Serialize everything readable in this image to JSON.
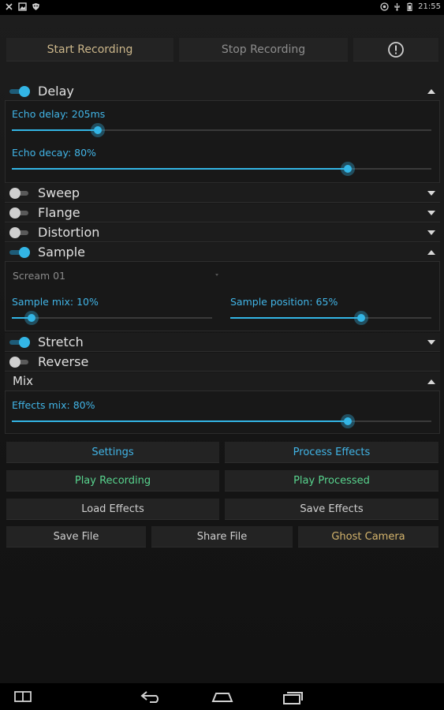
{
  "status_bar": {
    "left_icons": [
      "close-icon",
      "photo-icon",
      "shield-icon"
    ],
    "right_icons": [
      "chrome-icon",
      "usb-icon",
      "battery-icon"
    ],
    "time": "21:55"
  },
  "colors": {
    "accent": "#33b5e5",
    "label_blue": "#41b4e6",
    "label_green": "#58d48e",
    "label_gold": "#d4b46c"
  },
  "top_buttons": {
    "start_label": "Start Recording",
    "stop_label": "Stop Recording",
    "info_icon": "info-icon"
  },
  "delay": {
    "label": "Delay",
    "enabled": true,
    "expanded": true,
    "echo_delay_label": "Echo delay: 205ms",
    "echo_delay_fraction": 0.205,
    "echo_decay_label": "Echo decay: 80%",
    "echo_decay_fraction": 0.8
  },
  "sweep": {
    "label": "Sweep",
    "enabled": false,
    "expanded": false
  },
  "flange": {
    "label": "Flange",
    "enabled": false,
    "expanded": false
  },
  "distortion": {
    "label": "Distortion",
    "enabled": false,
    "expanded": false
  },
  "sample": {
    "label": "Sample",
    "enabled": true,
    "expanded": true,
    "selected": "Scream 01",
    "mix_label": "Sample mix: 10%",
    "mix_fraction": 0.1,
    "position_label": "Sample position: 65%",
    "position_fraction": 0.65
  },
  "stretch": {
    "label": "Stretch",
    "enabled": true,
    "expanded": false
  },
  "reverse": {
    "label": "Reverse",
    "enabled": false
  },
  "mix": {
    "label": "Mix",
    "expanded": true,
    "effects_mix_label": "Effects mix: 80%",
    "effects_mix_fraction": 0.8
  },
  "actions": {
    "settings": "Settings",
    "process_effects": "Process Effects",
    "play_recording": "Play Recording",
    "play_processed": "Play Processed",
    "load_effects": "Load Effects",
    "save_effects": "Save Effects",
    "save_file": "Save File",
    "share_file": "Share File",
    "ghost_camera": "Ghost Camera"
  },
  "nav_bar": {
    "icons": [
      "split-screen-icon",
      "back-icon",
      "home-icon",
      "recent-apps-icon"
    ]
  }
}
